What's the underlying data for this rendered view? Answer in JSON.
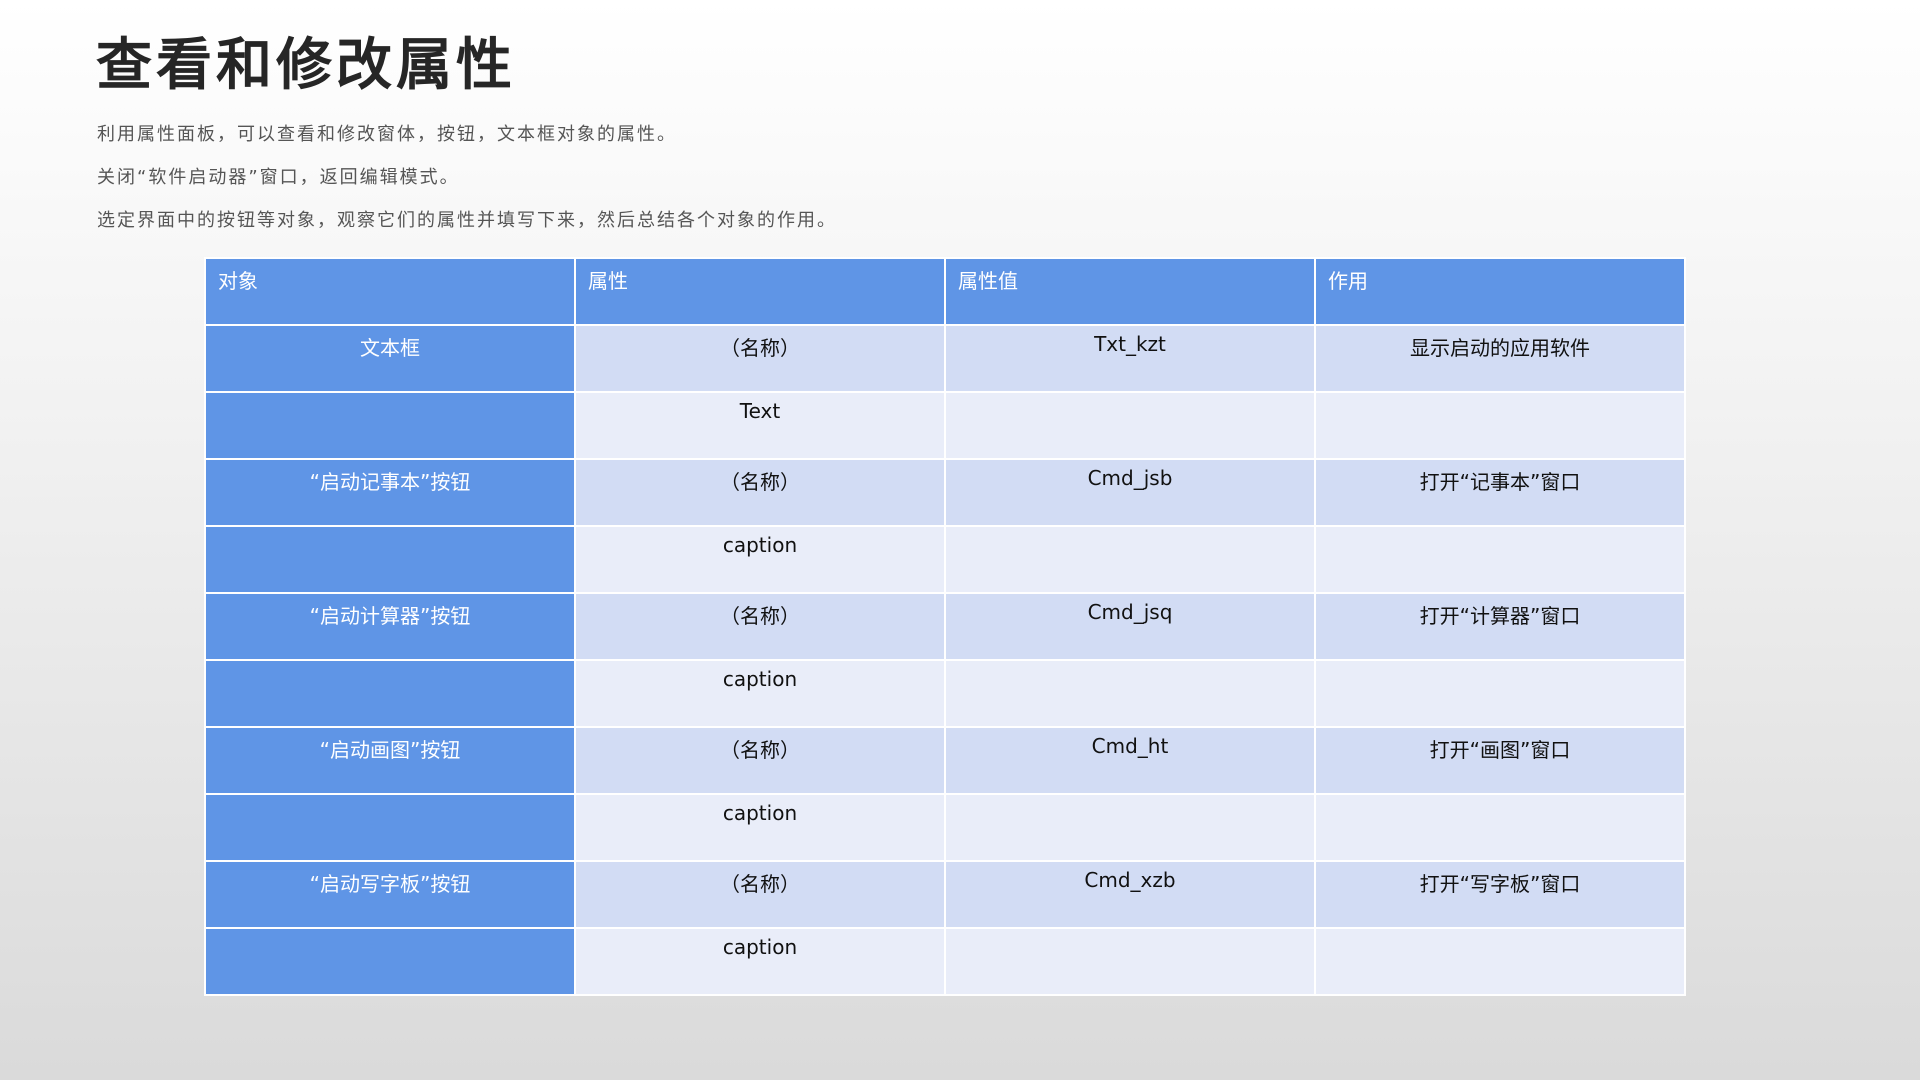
{
  "title": "查看和修改属性",
  "intro": [
    "利用属性面板，可以查看和修改窗体，按钮，文本框对象的属性。",
    "关闭“软件启动器”窗口，返回编辑模式。",
    "选定界面中的按钮等对象，观察它们的属性并填写下来，然后总结各个对象的作用。"
  ],
  "table": {
    "headers": [
      "对象",
      "属性",
      "属性值",
      "作用"
    ],
    "rows": [
      {
        "object": "文本框",
        "property": "（名称）",
        "value": "Txt_kzt",
        "purpose": "显示启动的应用软件"
      },
      {
        "object": "",
        "property": "Text",
        "value": "",
        "purpose": ""
      },
      {
        "object": "“启动记事本”按钮",
        "property": "（名称）",
        "value": "Cmd_jsb",
        "purpose": "打开“记事本”窗口"
      },
      {
        "object": "",
        "property": "caption",
        "value": "",
        "purpose": ""
      },
      {
        "object": "“启动计算器”按钮",
        "property": "（名称）",
        "value": "Cmd_jsq",
        "purpose": "打开“计算器”窗口"
      },
      {
        "object": "",
        "property": "caption",
        "value": "",
        "purpose": ""
      },
      {
        "object": "“启动画图”按钮",
        "property": "（名称）",
        "value": "Cmd_ht",
        "purpose": "打开“画图”窗口"
      },
      {
        "object": "",
        "property": "caption",
        "value": "",
        "purpose": ""
      },
      {
        "object": "“启动写字板”按钮",
        "property": "（名称）",
        "value": "Cmd_xzb",
        "purpose": "打开“写字板”窗口"
      },
      {
        "object": "",
        "property": "caption",
        "value": "",
        "purpose": ""
      }
    ]
  },
  "colors": {
    "header_bg": "#5f95e6",
    "row_odd_bg": "#d2dcf4",
    "row_even_bg": "#e9edf9"
  }
}
